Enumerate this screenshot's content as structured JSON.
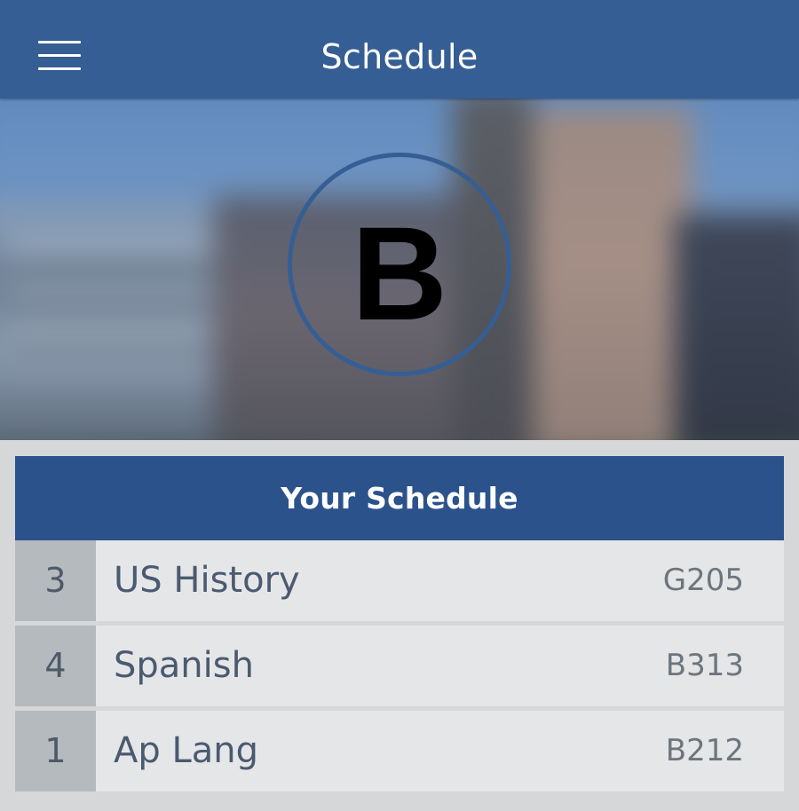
{
  "header": {
    "title": "Schedule",
    "menu_icon": "hamburger-menu-icon"
  },
  "hero": {
    "letter": "B"
  },
  "schedule": {
    "heading": "Your Schedule",
    "rows": [
      {
        "period": "3",
        "course": "US History",
        "room": "G205"
      },
      {
        "period": "4",
        "course": "Spanish",
        "room": "B313"
      },
      {
        "period": "1",
        "course": "Ap Lang",
        "room": "B212"
      }
    ]
  },
  "colors": {
    "header_bg": "#355e94",
    "schedule_header_bg": "#2c528c",
    "badge_ring": "#355e94",
    "row_bg": "#e5e6e7",
    "period_bg": "#b5babf",
    "page_bg": "#d6d7d8"
  }
}
